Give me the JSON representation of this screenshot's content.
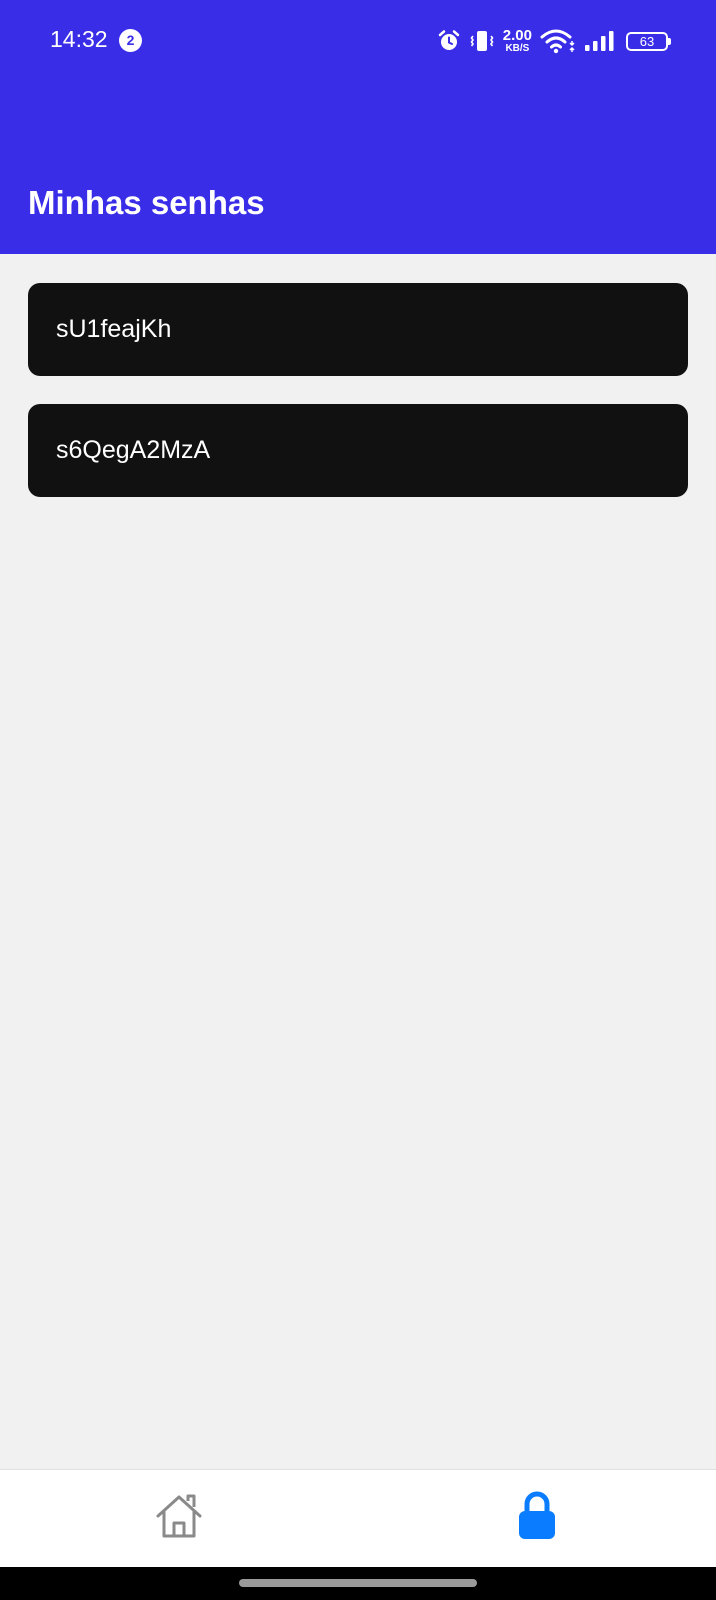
{
  "status_bar": {
    "time": "14:32",
    "notification_count": "2",
    "net_speed_value": "2.00",
    "net_speed_unit": "KB/S",
    "battery": "63"
  },
  "header": {
    "title": "Minhas senhas",
    "background_color": "#392de8"
  },
  "passwords": [
    {
      "value": "sU1feajKh"
    },
    {
      "value": "s6QegA2MzA"
    }
  ],
  "bottom_nav": {
    "items": [
      {
        "icon": "home-icon",
        "active": false,
        "color": "#8a8a8a"
      },
      {
        "icon": "lock-icon",
        "active": true,
        "color": "#0a7cff"
      }
    ]
  }
}
